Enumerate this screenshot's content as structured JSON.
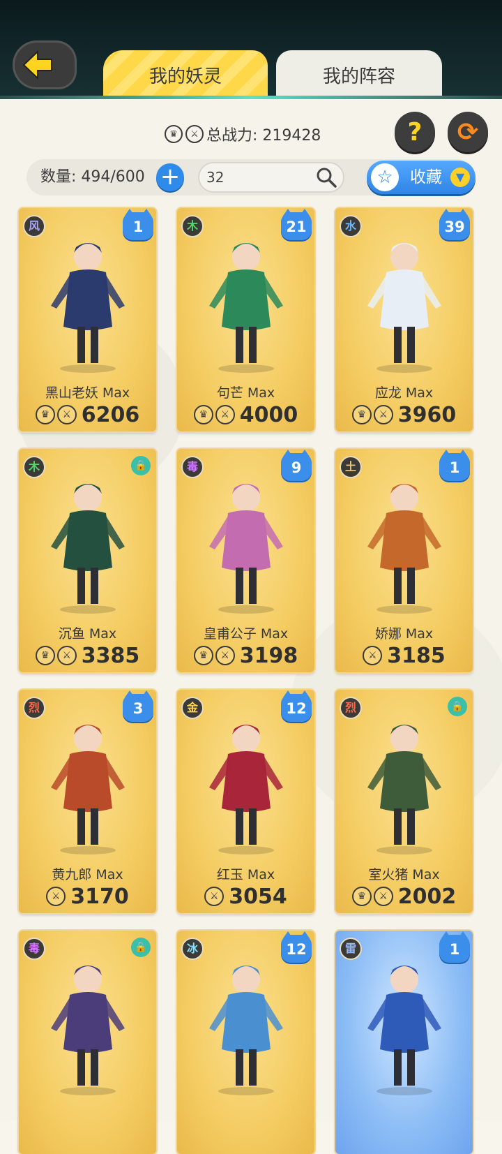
{
  "header": {
    "tabs": [
      {
        "label": "我的妖灵",
        "active": true
      },
      {
        "label": "我的阵容",
        "active": false
      }
    ]
  },
  "summary": {
    "total_power_label": "总战力: 219428"
  },
  "filter": {
    "count_label": "数量: 494/600",
    "search_value": "32",
    "favorite_label": "收藏"
  },
  "colors": {
    "accent_yellow": "#ffd84a",
    "accent_blue": "#2e84e6",
    "card_gold": "#f4cc62"
  },
  "cards": [
    {
      "element": "风",
      "element_color": "#a9a6ff",
      "badge": "1",
      "badge_type": "level",
      "name": "黑山老妖 Max",
      "power": "6206",
      "show_crown": true,
      "figure_color": "#2c3b6e",
      "bg": "gold"
    },
    {
      "element": "木",
      "element_color": "#57d36a",
      "badge": "21",
      "badge_type": "level",
      "name": "句芒 Max",
      "power": "4000",
      "show_crown": true,
      "figure_color": "#2c8a5a",
      "bg": "gold"
    },
    {
      "element": "水",
      "element_color": "#6fb6ff",
      "badge": "39",
      "badge_type": "level",
      "name": "应龙 Max",
      "power": "3960",
      "show_crown": true,
      "figure_color": "#e8eef5",
      "bg": "gold"
    },
    {
      "element": "木",
      "element_color": "#57d36a",
      "badge": "",
      "badge_type": "lock",
      "name": "沉鱼 Max",
      "power": "3385",
      "show_crown": true,
      "figure_color": "#23503f",
      "bg": "gold"
    },
    {
      "element": "毒",
      "element_color": "#d07bff",
      "badge": "9",
      "badge_type": "level",
      "name": "皇甫公子 Max",
      "power": "3198",
      "show_crown": true,
      "figure_color": "#c46cb0",
      "bg": "gold"
    },
    {
      "element": "土",
      "element_color": "#e7c37a",
      "badge": "1",
      "badge_type": "level",
      "name": "娇娜 Max",
      "power": "3185",
      "show_crown": false,
      "figure_color": "#c4682c",
      "bg": "gold"
    },
    {
      "element": "烈",
      "element_color": "#ff6a4a",
      "badge": "3",
      "badge_type": "level",
      "name": "黄九郎 Max",
      "power": "3170",
      "show_crown": false,
      "figure_color": "#b94a2a",
      "bg": "gold"
    },
    {
      "element": "金",
      "element_color": "#ffd84a",
      "badge": "12",
      "badge_type": "level",
      "name": "红玉 Max",
      "power": "3054",
      "show_crown": false,
      "figure_color": "#a8253a",
      "bg": "gold"
    },
    {
      "element": "烈",
      "element_color": "#ff6a4a",
      "badge": "",
      "badge_type": "lock",
      "name": "室火猪 Max",
      "power": "2002",
      "show_crown": true,
      "figure_color": "#3e5b3a",
      "bg": "gold"
    },
    {
      "element": "毒",
      "element_color": "#d07bff",
      "badge": "",
      "badge_type": "lock",
      "name": "",
      "power": "",
      "show_crown": false,
      "figure_color": "#4b3c7a",
      "bg": "gold"
    },
    {
      "element": "冰",
      "element_color": "#7fe0ff",
      "badge": "12",
      "badge_type": "level",
      "name": "",
      "power": "",
      "show_crown": false,
      "figure_color": "#4a8fd0",
      "bg": "gold"
    },
    {
      "element": "雷",
      "element_color": "#8fb8ff",
      "badge": "1",
      "badge_type": "level",
      "name": "",
      "power": "",
      "show_crown": false,
      "figure_color": "#2f5bb8",
      "bg": "blue"
    }
  ]
}
